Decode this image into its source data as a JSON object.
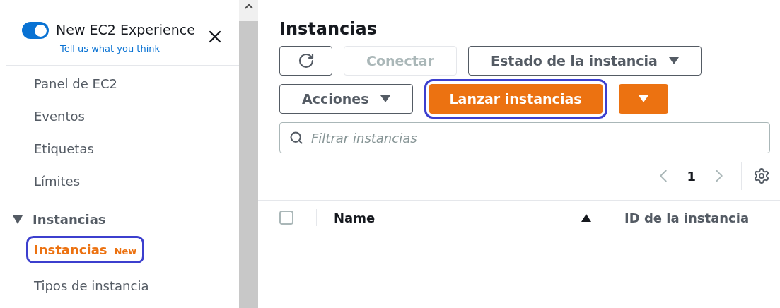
{
  "banner": {
    "toggle_on": true,
    "title": "New EC2 Experience",
    "link": "Tell us what you think"
  },
  "sidebar": {
    "items": [
      {
        "label": "Panel de EC2",
        "selected": false
      },
      {
        "label": "Eventos",
        "selected": false
      },
      {
        "label": "Etiquetas",
        "selected": false
      },
      {
        "label": "Límites",
        "selected": false
      }
    ],
    "sections": [
      {
        "label": "Instancias",
        "expanded": true,
        "children": [
          {
            "label": "Instancias",
            "badge": "New",
            "selected": true,
            "highlighted": true
          },
          {
            "label": "Tipos de instancia",
            "selected": false,
            "highlighted": false
          }
        ]
      }
    ]
  },
  "main": {
    "title": "Instancias",
    "toolbar": [
      {
        "kind": "refresh",
        "disabled": false
      },
      {
        "kind": "button",
        "label": "Conectar",
        "disabled": true
      },
      {
        "kind": "dropdown",
        "label": "Estado de la instancia",
        "disabled": false
      },
      {
        "kind": "break"
      },
      {
        "kind": "dropdown",
        "label": "Acciones",
        "disabled": false
      },
      {
        "kind": "primary",
        "label": "Lanzar instancias",
        "disabled": false,
        "highlighted": true
      },
      {
        "kind": "primary-caret",
        "disabled": false
      }
    ],
    "search": {
      "placeholder": "Filtrar instancias"
    },
    "pagination": {
      "page": "1"
    },
    "table": {
      "select_all_checked": false,
      "columns": [
        {
          "label": "Name",
          "sorted": true
        },
        {
          "label": "ID de la instancia",
          "sorted": false
        }
      ]
    }
  }
}
